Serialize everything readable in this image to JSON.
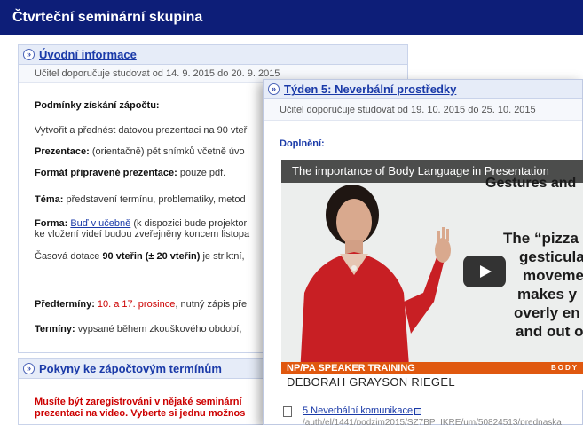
{
  "header": {
    "title": "Čtvrteční seminární skupina"
  },
  "section1": {
    "title": "Úvodní informace",
    "dates": "Učitel doporučuje studovat od 14. 9. 2015 do 20. 9. 2015",
    "conditions_heading": "Podmínky získání zápočtu:",
    "line1": "Vytvořit a přednést datovou prezentaci na 90 vteř",
    "prezentace_label": "Prezentace:",
    "prezentace_text": " (orientačně) pět snímků včetně úvo",
    "format_label": "Formát připravené prezentace:",
    "format_text": " pouze pdf.",
    "tema_label": "Téma:",
    "tema_text": " představení termínu, problematiky, metod",
    "forma_label": "Forma:",
    "forma_link": "Buď v učebně",
    "forma_text": " (k dispozici bude projektor",
    "forma_line2": "ke vložení videí budou zveřejněny koncem listopa",
    "casova_pre": "Časová dotace ",
    "casova_bold": "90 vteřin (± 20 vteřin)",
    "casova_post": " je striktní,",
    "predterminy_label": "Předtermíny:",
    "predterminy_red": " 10. a 17. prosince",
    "predterminy_text": ", nutný zápis pře",
    "terminy_label": "Termíny:",
    "terminy_text": " vypsané během zkouškového období,"
  },
  "section2": {
    "title": "Pokyny ke zápočtovým termínům",
    "line1": "Musíte být zaregistrováni v nějaké seminární",
    "line2": "prezentaci na video. Vyberte si jednu možnos"
  },
  "overlay": {
    "title": "Týden 5: Neverbální prostředky",
    "dates": "Učitel doporučuje studovat od 19. 10. 2015 do 25. 10. 2015",
    "doplneni": "Doplnění:",
    "video": {
      "title": "The importance of Body Language in Presentation",
      "sub": "Gestures and",
      "lines": [
        "The “pizza p",
        "gesticulat",
        "movemen",
        "makes y",
        "overly en",
        "and out o"
      ],
      "banner": "NP/PA SPEAKER TRAINING",
      "banner_right": "BODY",
      "name": "DEBORAH GRAYSON RIEGEL"
    },
    "file_link": "5 Neverbální komunikace",
    "file_path": "/auth/el/1441/podzim2015/SZ7BP_IKRE/um/50824513/prednaska"
  },
  "colors": {
    "header_bg": "#0d1e78",
    "link": "#1a3aa8",
    "accent_red": "#cc0000",
    "banner": "#e0580f"
  }
}
